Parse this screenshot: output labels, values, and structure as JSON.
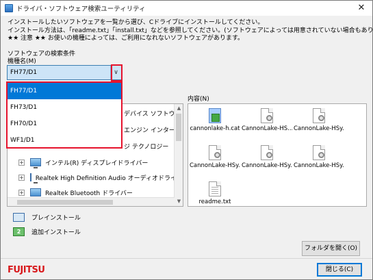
{
  "window": {
    "title": "ドライバ・ソフトウェア検索ユーティリティ",
    "close_glyph": "✕"
  },
  "intro": {
    "line1": "インストールしたいソフトウェアを一覧から選び、Cドライブにインストールしてください。",
    "line2": "インストール方法は、「readme.txt」「install.txt」などを参照してください。(ソフトウェアによっては用意されていない場合もあります)",
    "line3": "★★ 注意 ★★ お使いの機種によっては、ご利用になれないソフトウェアがあります。"
  },
  "search": {
    "section_label": "ソフトウェアの検索条件",
    "model_label": "機種名(M)",
    "selected_value": "FH77/D1",
    "options": [
      "FH77/D1",
      "FH73/D1",
      "FH70/D1",
      "WF1/D1"
    ],
    "selected_index": 0
  },
  "tree": {
    "items": [
      {
        "label": "デバイス ソフトウェア",
        "expanded": true
      },
      {
        "label": "エンジン インターフェイ"
      },
      {
        "label": "ジ テクノロジー"
      },
      {
        "label": "インテル(R) ディスプレイドライバー"
      },
      {
        "label": "Realtek High Definition Audio オーディオドライバ"
      },
      {
        "label": "Realtek Bluetooth ドライバー"
      }
    ]
  },
  "contents": {
    "label": "内容(N)",
    "files": [
      {
        "name": "cannonlake-h.cat",
        "icon": "catalog-file-icon"
      },
      {
        "name": "CannonLake-HS...",
        "icon": "settings-file-icon"
      },
      {
        "name": "CannonLake-HSy...",
        "icon": "settings-file-icon"
      },
      {
        "name": "CannonLake-HSy...",
        "icon": "settings-file-icon"
      },
      {
        "name": "CannonLake-HSy...",
        "icon": "settings-file-icon"
      },
      {
        "name": "CannonLake-HSy...",
        "icon": "settings-file-icon"
      },
      {
        "name": "readme.txt",
        "icon": "text-file-icon"
      }
    ]
  },
  "legend": {
    "preinstall": "プレインストール",
    "additional": "追加インストール",
    "additional_icon_glyph": "2"
  },
  "buttons": {
    "open_folder": "フォルダを開く(O)",
    "close": "閉じる(C)"
  },
  "brand": {
    "logo_text": "FUJITSU",
    "color": "#d8191c"
  },
  "colors": {
    "highlight": "#e6122c",
    "selection": "#0078d7"
  }
}
